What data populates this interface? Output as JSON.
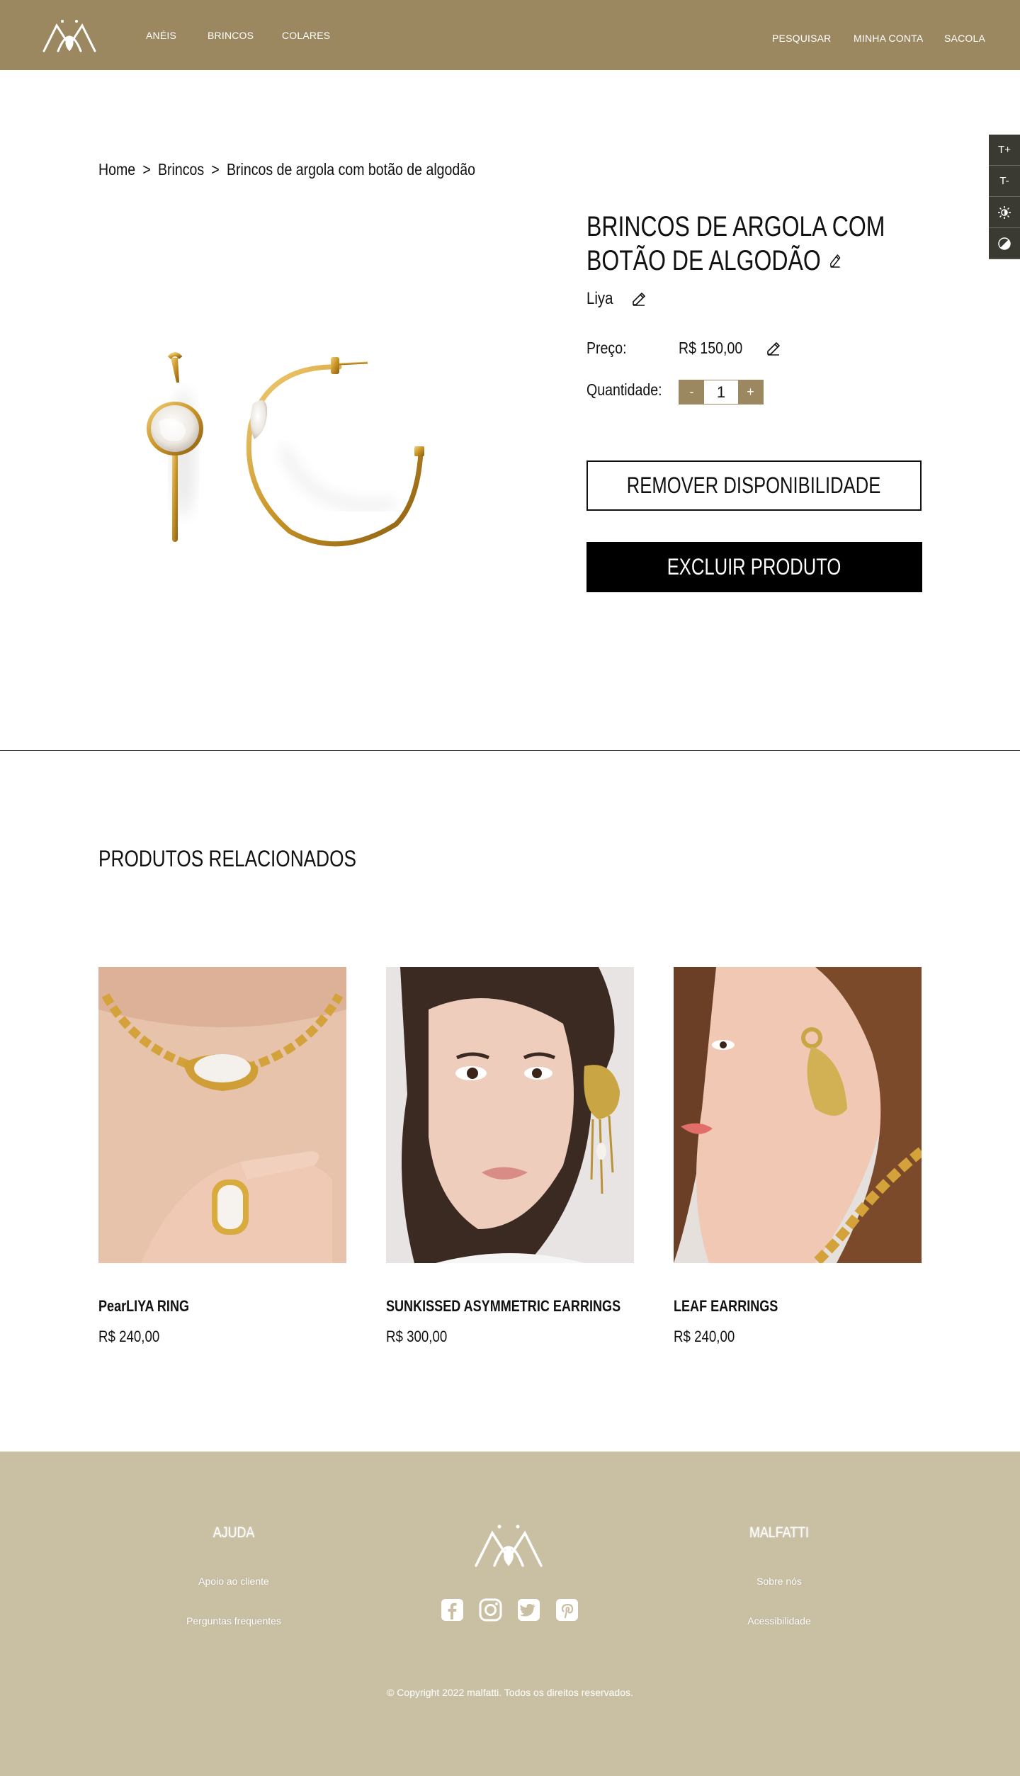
{
  "header": {
    "nav_left": [
      "ANÉIS",
      "BRINCOS",
      "COLARES"
    ],
    "nav_right": [
      "PESQUISAR",
      "MINHA CONTA",
      "SACOLA"
    ]
  },
  "accessibility": {
    "increase_font": "T+",
    "decrease_font": "T-"
  },
  "breadcrumb": {
    "home": "Home",
    "category": "Brincos",
    "current": "Brincos de argola com botão de algodão",
    "separator": ">"
  },
  "product": {
    "title_line1": "BRINCOS DE ARGOLA COM",
    "title_line2": "BOTÃO DE ALGODÃO",
    "brand": "Liya",
    "price_label": "Preço:",
    "price": "R$ 150,00",
    "quantity_label": "Quantidade:",
    "quantity": "1",
    "decrement": "-",
    "increment": "+",
    "remove_availability_label": "REMOVER DISPONIBILIDADE",
    "delete_product_label": "EXCLUIR PRODUTO"
  },
  "related": {
    "title": "PRODUTOS RELACIONADOS",
    "items": [
      {
        "name": "PearLIYA RING",
        "price": "R$ 240,00"
      },
      {
        "name": "SUNKISSED ASYMMETRIC EARRINGS",
        "price": "R$ 300,00"
      },
      {
        "name": "LEAF EARRINGS",
        "price": "R$ 240,00"
      }
    ]
  },
  "footer": {
    "help_title": "AJUDA",
    "help_links": [
      "Apoio ao cliente",
      "Perguntas frequentes"
    ],
    "brand_title": "MALFATTI",
    "brand_links": [
      "Sobre nós",
      "Acessibilidade"
    ],
    "copyright": "© Copyright 2022 malfatti. Todos os direitos reservados."
  },
  "colors": {
    "header_bg": "#9c8860",
    "footer_bg": "#c9c0a4",
    "accent": "#9c8860",
    "dark_button": "#000000"
  }
}
